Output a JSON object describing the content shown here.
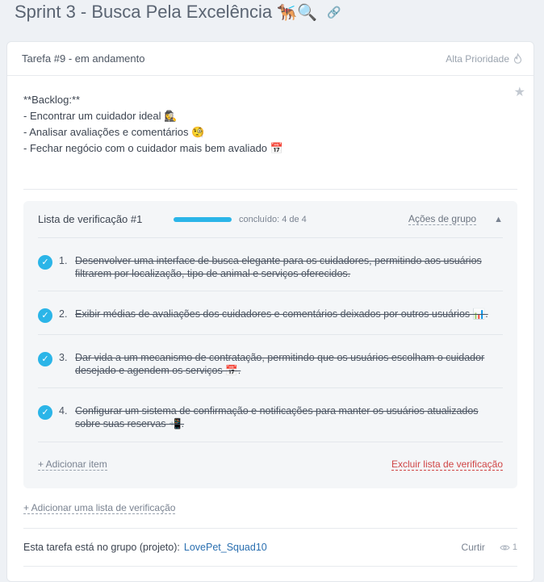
{
  "page": {
    "title": "Sprint 3 - Busca Pela Excelência",
    "title_emojis": "🐕‍🦺🔍"
  },
  "task": {
    "header": "Tarefa #9 - em andamento",
    "priority": "Alta Prioridade",
    "description_lines": [
      "**Backlog:**",
      "- Encontrar um cuidador ideal 🕵️‍♀️",
      "- Analisar avaliações e comentários 🧐",
      "- Fechar negócio com o cuidador mais bem avaliado 📅"
    ]
  },
  "checklist": {
    "title": "Lista de verificação #1",
    "progress": 1.0,
    "done_text": "concluído: 4 de 4",
    "group_actions": "Ações de grupo",
    "items": [
      {
        "num": "1.",
        "text": "Desenvolver uma interface de busca elegante para os cuidadores, permitindo aos usuários filtrarem por localização, tipo de animal e serviços oferecidos."
      },
      {
        "num": "2.",
        "text": "Exibir médias de avaliações dos cuidadores e comentários deixados por outros usuários 📊."
      },
      {
        "num": "3.",
        "text": "Dar vida a um mecanismo de contratação, permitindo que os usuários escolham o cuidador desejado e agendem os serviços 📅."
      },
      {
        "num": "4.",
        "text": "Configurar um sistema de confirmação e notificações para manter os usuários atualizados sobre suas reservas 📲."
      }
    ],
    "add_item": "+ Adicionar item",
    "delete_list": "Excluir lista de verificação"
  },
  "add_checklist": "+ Adicionar uma lista de verificação",
  "footer": {
    "group_text": "Esta tarefa está no grupo (projeto):",
    "group_link": "LovePet_Squad10",
    "like": "Curtir",
    "views": "1"
  },
  "colors": {
    "accent": "#2bb5e8",
    "danger": "#d04545",
    "link": "#2a6fb0"
  }
}
